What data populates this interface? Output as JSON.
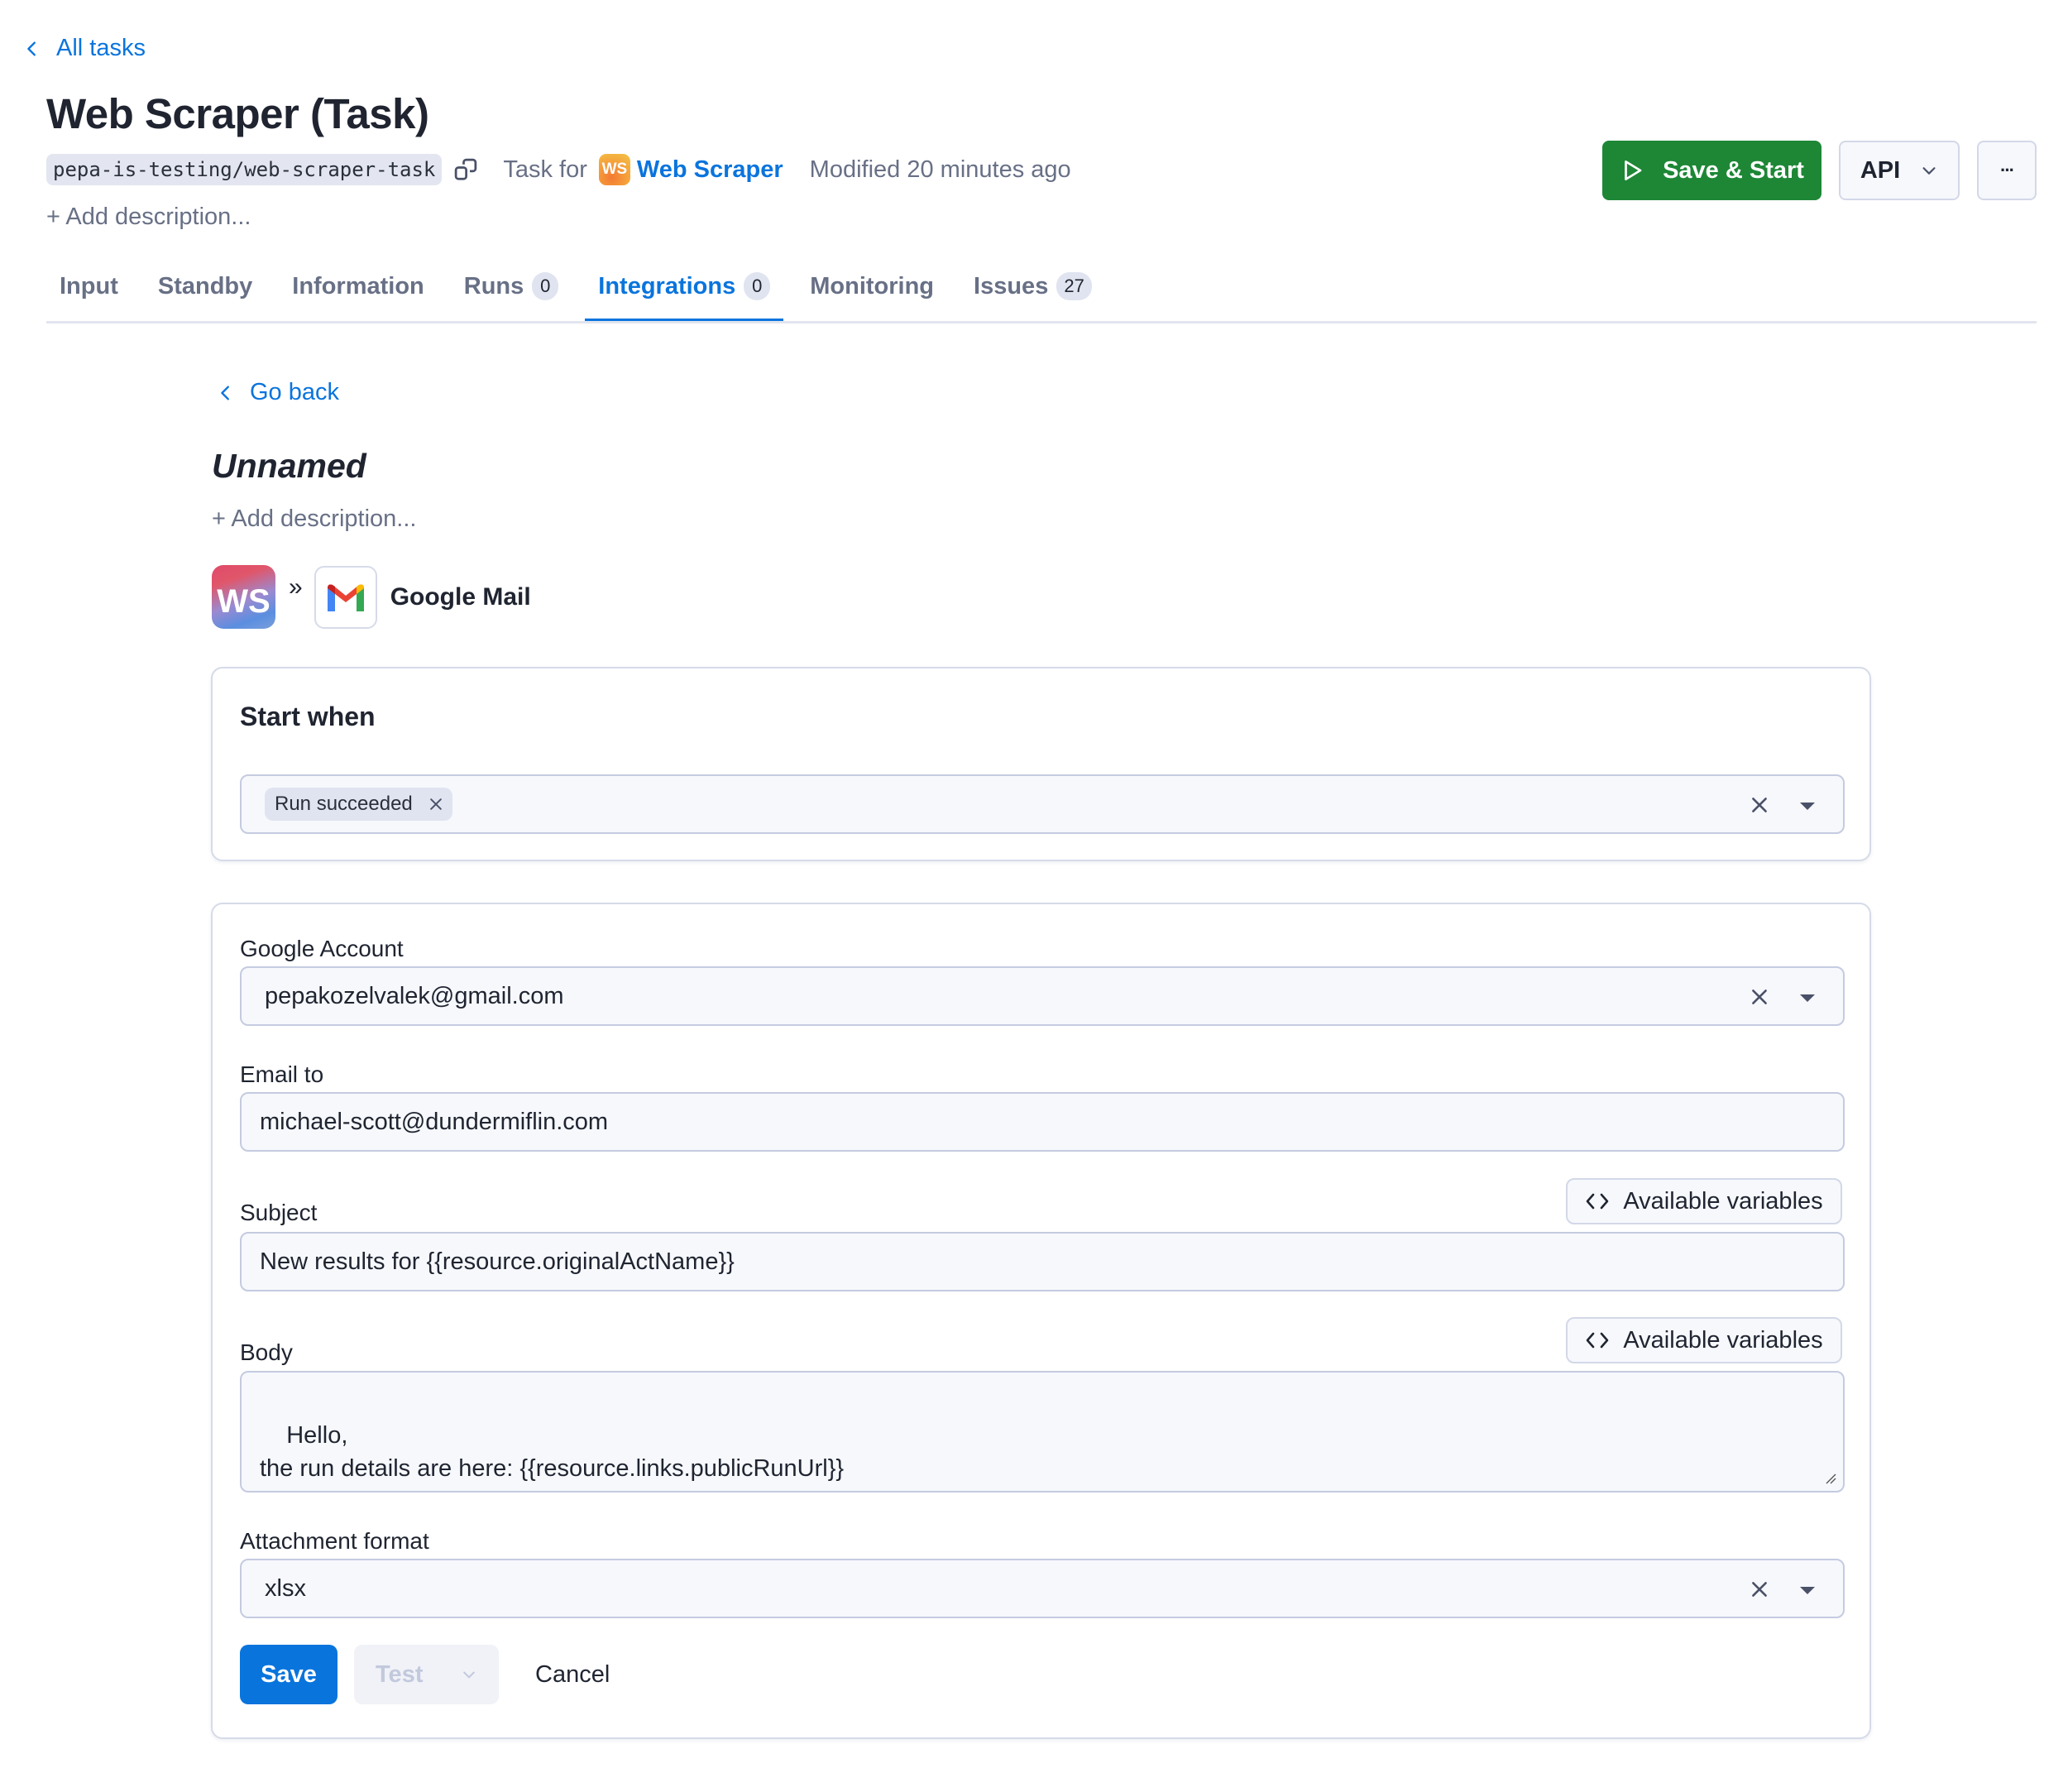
{
  "nav": {
    "back_label": "All tasks"
  },
  "header": {
    "title": "Web Scraper (Task)",
    "slug": "pepa-is-testing/web-scraper-task",
    "task_for_label": "Task for",
    "actor_badge": "WS",
    "actor_name": "Web Scraper",
    "modified": "Modified 20 minutes ago",
    "add_description": "+ Add description...",
    "save_start_label": "Save & Start",
    "api_label": "API",
    "more_label": "···"
  },
  "tabs": [
    {
      "label": "Input"
    },
    {
      "label": "Standby"
    },
    {
      "label": "Information"
    },
    {
      "label": "Runs",
      "count": "0"
    },
    {
      "label": "Integrations",
      "count": "0",
      "active": true
    },
    {
      "label": "Monitoring"
    },
    {
      "label": "Issues",
      "count": "27"
    }
  ],
  "integration": {
    "go_back": "Go back",
    "name": "Unnamed",
    "add_description": "+ Add description...",
    "source_badge": "WS",
    "target_name": "Google Mail",
    "start_when": {
      "title": "Start when",
      "chips": [
        "Run succeeded"
      ]
    },
    "form": {
      "google_account": {
        "label": "Google Account",
        "value": "pepakozelvalek@gmail.com"
      },
      "email_to": {
        "label": "Email to",
        "value": "michael-scott@dundermiflin.com"
      },
      "subject": {
        "label": "Subject",
        "value": "New results for {{resource.originalActName}}",
        "variables_label": "Available variables"
      },
      "body": {
        "label": "Body",
        "value": "Hello,\nthe run details are here: {{resource.links.publicRunUrl}}",
        "variables_label": "Available variables"
      },
      "attachment_format": {
        "label": "Attachment format",
        "value": "xlsx"
      }
    },
    "actions": {
      "save": "Save",
      "test": "Test",
      "cancel": "Cancel"
    }
  },
  "colors": {
    "accent": "#0a74dd",
    "primary_green": "#1d8736"
  }
}
